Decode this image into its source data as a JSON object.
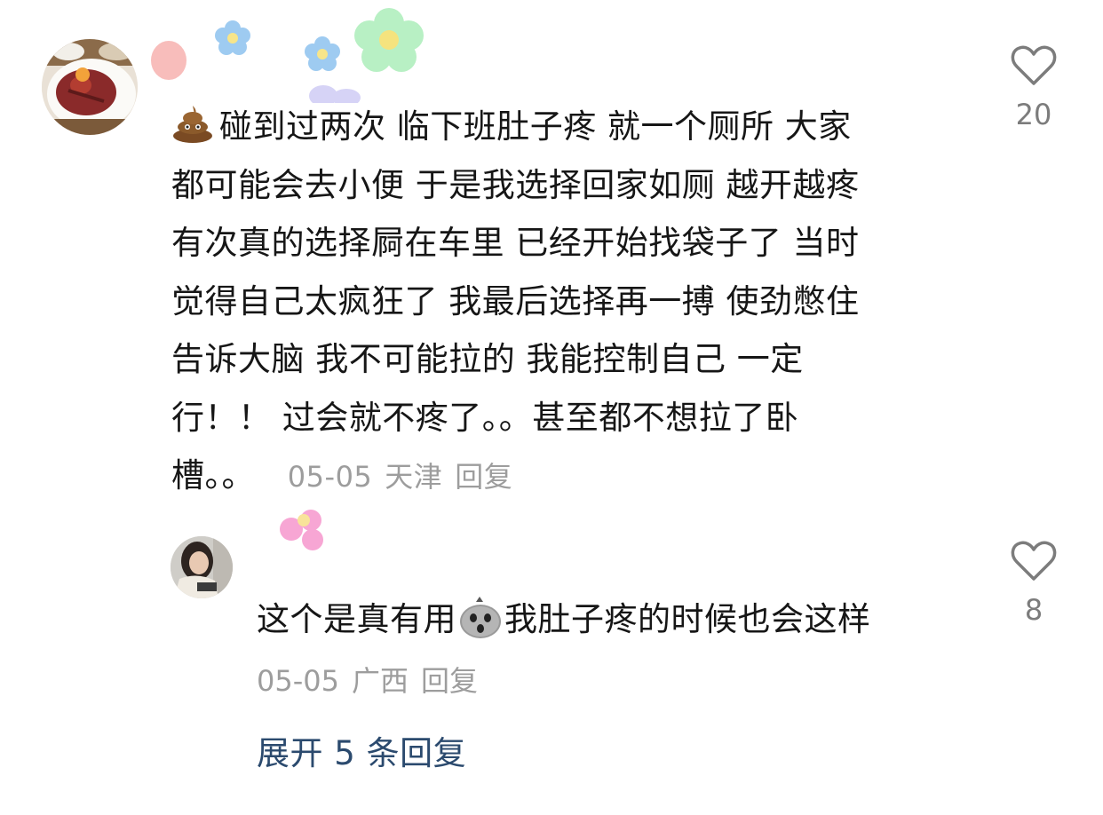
{
  "comment": {
    "lines": [
      "碰到过两次 临下班肚子疼 就一个厕所 大家",
      "都可能会去小便 于是我选择回家如厕 越开越疼",
      "有次真的选择屙在车里 已经开始找袋子了 当时",
      "觉得自己太疯狂了 我最后选择再一搏 使劲憋住",
      "告诉大脑 我不可能拉的 我能控制自己 一定",
      "行！！ 过会就不疼了。。甚至都不想拉了卧",
      "槽。。"
    ],
    "leading_emoji": "poop-emoji",
    "date": "05-05",
    "location": "天津",
    "reply_label": "回复",
    "likes": "20"
  },
  "reply": {
    "text_before_emoji": "这个是真有用",
    "emoji": "scared-face-emoji",
    "text_after_emoji": "我肚子疼的时候也会这样",
    "date": "05-05",
    "location": "广西",
    "reply_label": "回复",
    "likes": "8"
  },
  "expand_replies": "展开 5 条回复",
  "colors": {
    "text": "#161616",
    "meta": "#9d9d9d",
    "like_count": "#7c7c7c",
    "link": "#2b4a6e"
  }
}
